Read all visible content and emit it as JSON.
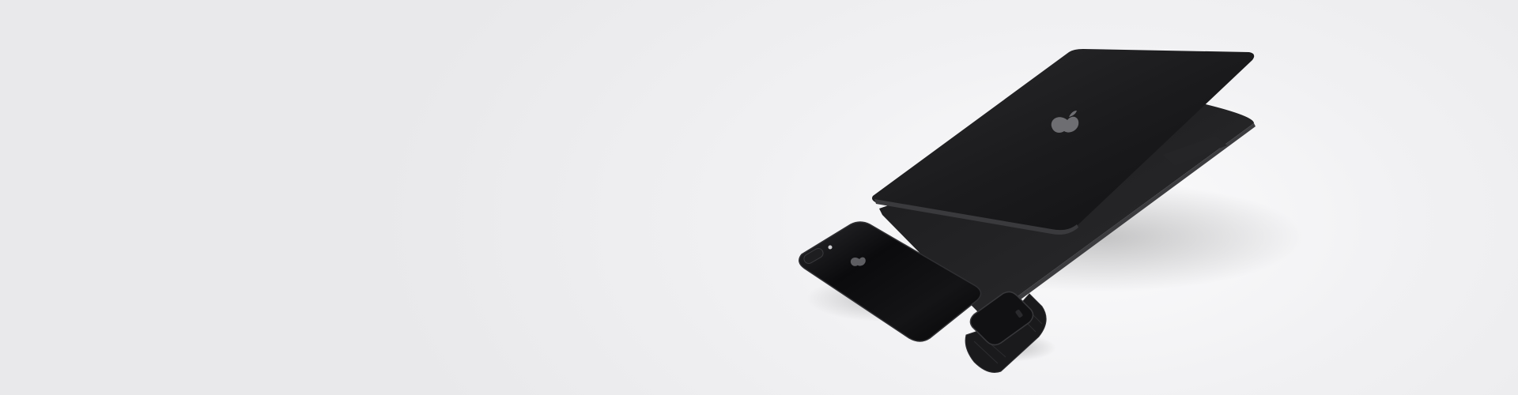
{
  "banner": {
    "background": "#efeff1",
    "devices": [
      {
        "name": "laptop",
        "color": "#1c1c1e"
      },
      {
        "name": "phone",
        "color": "#0e0e10"
      },
      {
        "name": "watch",
        "color": "#161618"
      }
    ]
  }
}
